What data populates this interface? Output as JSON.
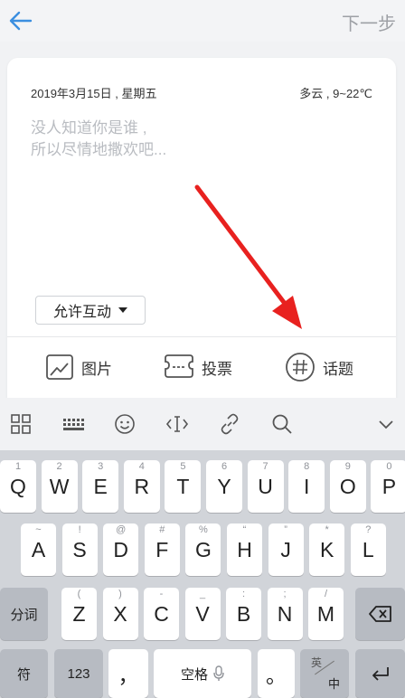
{
  "header": {
    "next_label": "下一步"
  },
  "post": {
    "date": "2019年3月15日 , 星期五",
    "weather": "多云 , 9~22℃",
    "placeholder_line1": "没人知道你是谁 ,",
    "placeholder_line2": "所以尽情地撒欢吧...",
    "allow_interaction_label": "允许互动"
  },
  "toolbar": {
    "image_label": "图片",
    "vote_label": "投票",
    "topic_label": "话题"
  },
  "keyboard": {
    "row1": [
      {
        "main": "Q",
        "sub": "1"
      },
      {
        "main": "W",
        "sub": "2"
      },
      {
        "main": "E",
        "sub": "3"
      },
      {
        "main": "R",
        "sub": "4"
      },
      {
        "main": "T",
        "sub": "5"
      },
      {
        "main": "Y",
        "sub": "6"
      },
      {
        "main": "U",
        "sub": "7"
      },
      {
        "main": "I",
        "sub": "8"
      },
      {
        "main": "O",
        "sub": "9"
      },
      {
        "main": "P",
        "sub": "0"
      }
    ],
    "row2": [
      {
        "main": "A",
        "sub": "~"
      },
      {
        "main": "S",
        "sub": "!"
      },
      {
        "main": "D",
        "sub": "@"
      },
      {
        "main": "F",
        "sub": "#"
      },
      {
        "main": "G",
        "sub": "%"
      },
      {
        "main": "H",
        "sub": "“"
      },
      {
        "main": "J",
        "sub": "”"
      },
      {
        "main": "K",
        "sub": "*"
      },
      {
        "main": "L",
        "sub": "?"
      }
    ],
    "row3": [
      {
        "main": "Z",
        "sub": "("
      },
      {
        "main": "X",
        "sub": ")"
      },
      {
        "main": "C",
        "sub": "-"
      },
      {
        "main": "V",
        "sub": "_"
      },
      {
        "main": "B",
        "sub": ":"
      },
      {
        "main": "N",
        "sub": ";"
      },
      {
        "main": "M",
        "sub": "/"
      }
    ],
    "segment_label": "分词",
    "symbol_label": "符",
    "num_label": "123",
    "comma_label": "，",
    "space_label": "空格",
    "period_label": "。",
    "lang_top": "英",
    "lang_bottom": "中"
  }
}
